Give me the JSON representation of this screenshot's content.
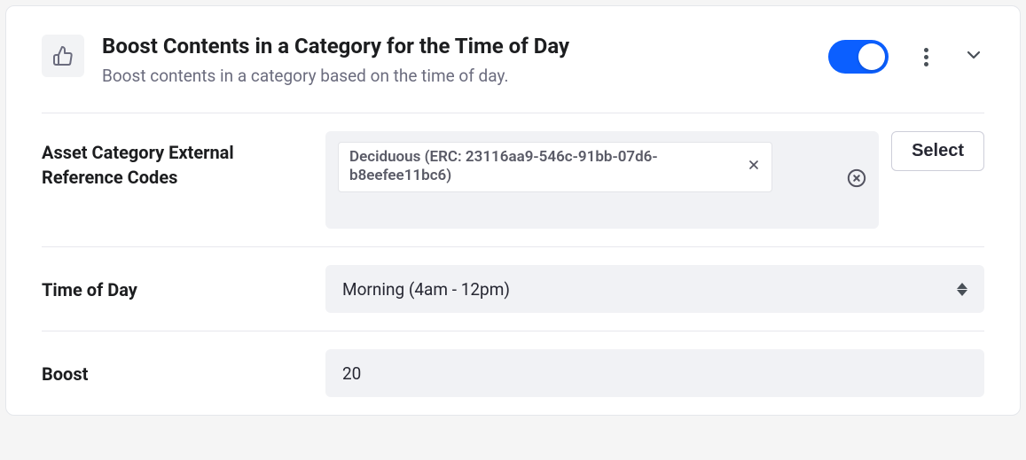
{
  "header": {
    "title": "Boost Contents in a Category for the Time of Day",
    "subtitle": "Boost contents in a category based on the time of day.",
    "toggle_on": true
  },
  "fields": {
    "asset_category": {
      "label": "Asset Category External Reference Codes",
      "select_button": "Select",
      "tags": [
        {
          "text": "Deciduous (ERC: 23116aa9-546c-91bb-07d6-b8eefee11bc6)"
        }
      ]
    },
    "time_of_day": {
      "label": "Time of Day",
      "value": "Morning (4am - 12pm)"
    },
    "boost": {
      "label": "Boost",
      "value": "20"
    }
  }
}
